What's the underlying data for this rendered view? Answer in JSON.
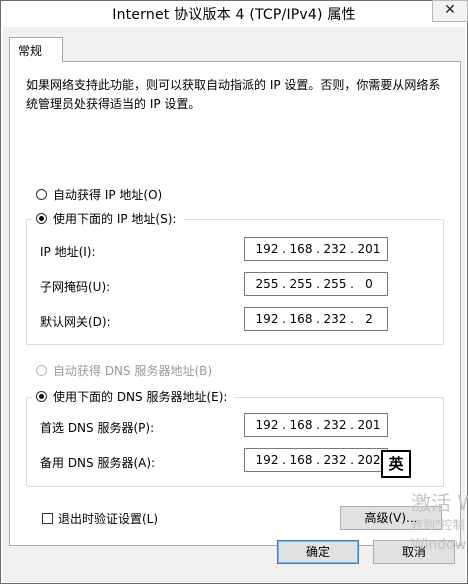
{
  "window": {
    "title": "Internet 协议版本 4 (TCP/IPv4) 属性",
    "close_glyph": "✕"
  },
  "tabs": [
    {
      "label": "常规"
    }
  ],
  "description": "如果网络支持此功能，则可以获取自动指派的 IP 设置。否则，你需要从网络系统管理员处获得适当的 IP 设置。",
  "ip_mode": {
    "auto_label": "自动获得 IP 地址(O)",
    "manual_label": "使用下面的 IP 地址(S):",
    "selected": "manual"
  },
  "ip_fields": [
    {
      "label": "IP 地址(I):",
      "octets": [
        "192",
        "168",
        "232",
        "201"
      ]
    },
    {
      "label": "子网掩码(U):",
      "octets": [
        "255",
        "255",
        "255",
        "0"
      ]
    },
    {
      "label": "默认网关(D):",
      "octets": [
        "192",
        "168",
        "232",
        "2"
      ]
    }
  ],
  "dns_mode": {
    "auto_label": "自动获得 DNS 服务器地址(B)",
    "manual_label": "使用下面的 DNS 服务器地址(E):",
    "selected": "manual"
  },
  "dns_fields": [
    {
      "label": "首选 DNS 服务器(P):",
      "octets": [
        "192",
        "168",
        "232",
        "201"
      ]
    },
    {
      "label": "备用 DNS 服务器(A):",
      "octets": [
        "192",
        "168",
        "232",
        "202"
      ]
    }
  ],
  "ime_indicator": "英",
  "validate_on_exit": {
    "label": "退出时验证设置(L)",
    "checked": false
  },
  "advanced_button": "高级(V)...",
  "ok_button": "确定",
  "cancel_button": "取消",
  "watermark": {
    "line1": "激活 W",
    "line2": "转到\"控制",
    "line3": "Window"
  }
}
